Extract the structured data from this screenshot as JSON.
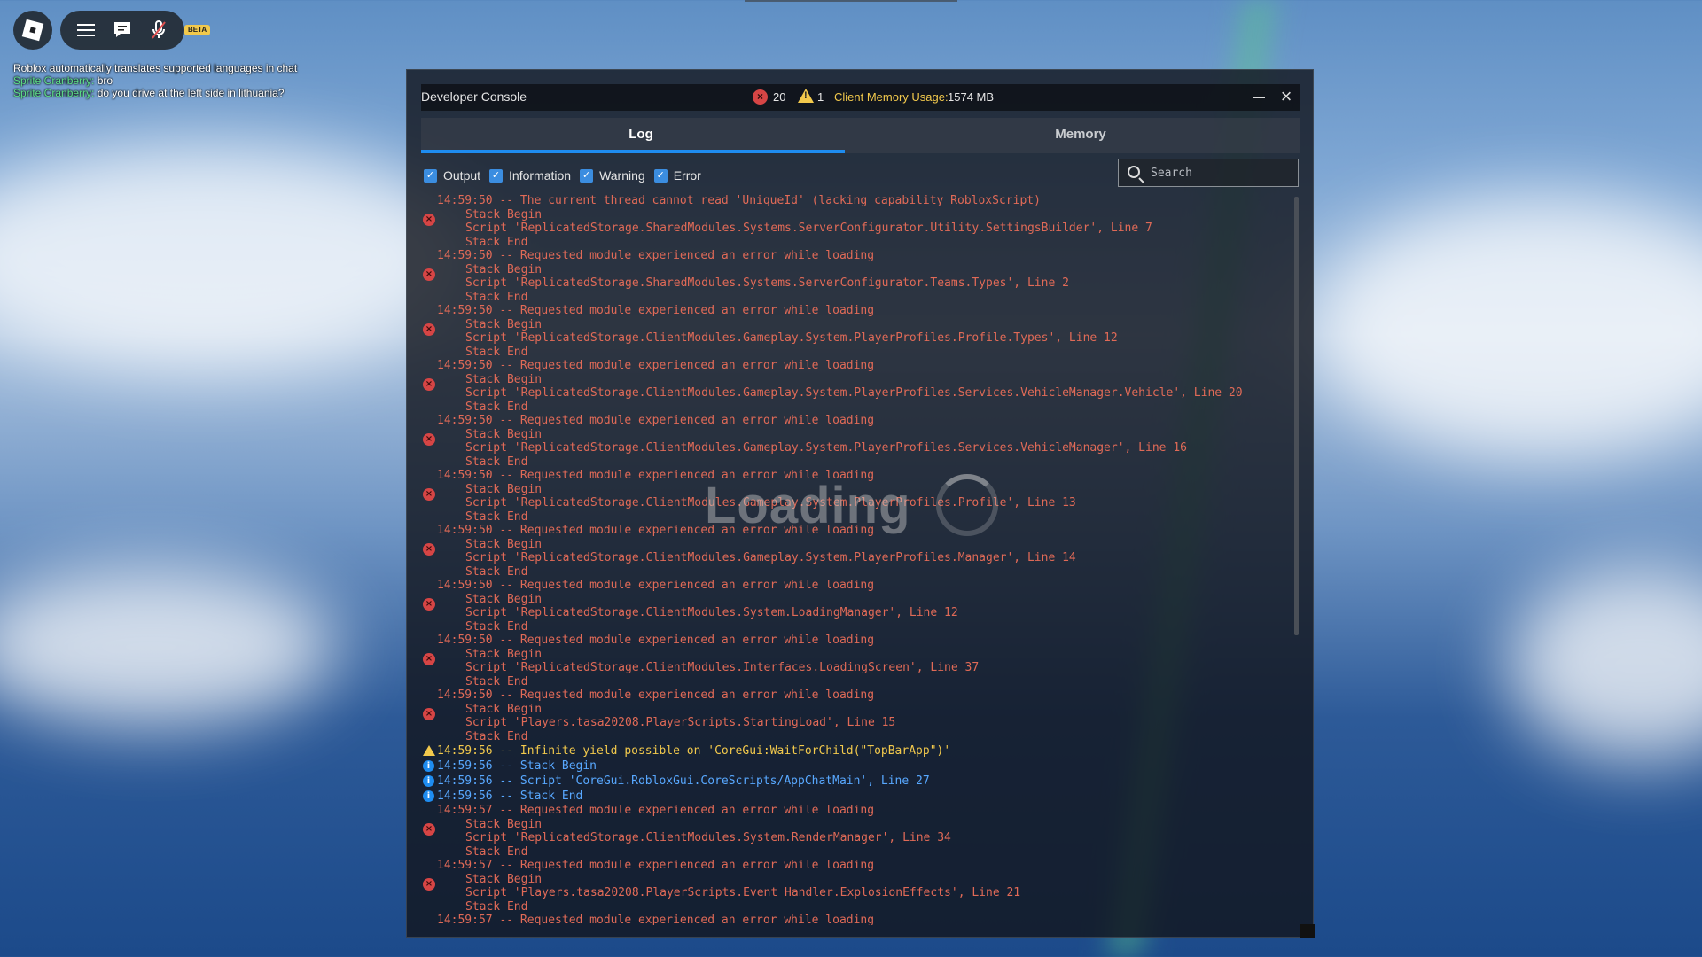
{
  "window": {
    "title": "Developer Console"
  },
  "stats": {
    "error_count": "20",
    "warning_count": "1",
    "memory_label": "Client Memory Usage:",
    "memory_value": "1574 MB"
  },
  "tabs": [
    {
      "label": "Log",
      "active": true
    },
    {
      "label": "Memory",
      "active": false
    }
  ],
  "filters": [
    {
      "label": "Output",
      "checked": true
    },
    {
      "label": "Information",
      "checked": true
    },
    {
      "label": "Warning",
      "checked": true
    },
    {
      "label": "Error",
      "checked": true
    }
  ],
  "search": {
    "placeholder": "Search"
  },
  "topbar": {
    "beta_label": "BETA"
  },
  "chat": {
    "notice": "Roblox automatically translates supported languages in chat",
    "messages": [
      {
        "speaker": "Sprite Cranberry:",
        "text": " bro"
      },
      {
        "speaker": "Sprite Cranberry:",
        "text": " do you drive at the left side in lithuania?"
      }
    ]
  },
  "overlay": {
    "loading_text": "Loading"
  },
  "log": [
    {
      "type": "error",
      "main": "14:59:50 -- The current thread cannot read 'UniqueId' (lacking capability RobloxScript)",
      "lines": [
        "Stack Begin",
        "Script 'ReplicatedStorage.SharedModules.Systems.ServerConfigurator.Utility.SettingsBuilder', Line 7",
        "Stack End"
      ]
    },
    {
      "type": "error",
      "main": "14:59:50 -- Requested module experienced an error while loading",
      "lines": [
        "Stack Begin",
        "Script 'ReplicatedStorage.SharedModules.Systems.ServerConfigurator.Teams.Types', Line 2",
        "Stack End"
      ]
    },
    {
      "type": "error",
      "main": "14:59:50 -- Requested module experienced an error while loading",
      "lines": [
        "Stack Begin",
        "Script 'ReplicatedStorage.ClientModules.Gameplay.System.PlayerProfiles.Profile.Types', Line 12",
        "Stack End"
      ]
    },
    {
      "type": "error",
      "main": "14:59:50 -- Requested module experienced an error while loading",
      "lines": [
        "Stack Begin",
        "Script 'ReplicatedStorage.ClientModules.Gameplay.System.PlayerProfiles.Services.VehicleManager.Vehicle', Line 20",
        "Stack End"
      ]
    },
    {
      "type": "error",
      "main": "14:59:50 -- Requested module experienced an error while loading",
      "lines": [
        "Stack Begin",
        "Script 'ReplicatedStorage.ClientModules.Gameplay.System.PlayerProfiles.Services.VehicleManager', Line 16",
        "Stack End"
      ]
    },
    {
      "type": "error",
      "main": "14:59:50 -- Requested module experienced an error while loading",
      "lines": [
        "Stack Begin",
        "Script 'ReplicatedStorage.ClientModules.Gameplay.System.PlayerProfiles.Profile', Line 13",
        "Stack End"
      ]
    },
    {
      "type": "error",
      "main": "14:59:50 -- Requested module experienced an error while loading",
      "lines": [
        "Stack Begin",
        "Script 'ReplicatedStorage.ClientModules.Gameplay.System.PlayerProfiles.Manager', Line 14",
        "Stack End"
      ]
    },
    {
      "type": "error",
      "main": "14:59:50 -- Requested module experienced an error while loading",
      "lines": [
        "Stack Begin",
        "Script 'ReplicatedStorage.ClientModules.System.LoadingManager', Line 12",
        "Stack End"
      ]
    },
    {
      "type": "error",
      "main": "14:59:50 -- Requested module experienced an error while loading",
      "lines": [
        "Stack Begin",
        "Script 'ReplicatedStorage.ClientModules.Interfaces.LoadingScreen', Line 37",
        "Stack End"
      ]
    },
    {
      "type": "error",
      "main": "14:59:50 -- Requested module experienced an error while loading",
      "lines": [
        "Stack Begin",
        "Script 'Players.tasa20208.PlayerScripts.StartingLoad', Line 15",
        "Stack End"
      ]
    },
    {
      "type": "warning",
      "main": "14:59:56 -- Infinite yield possible on 'CoreGui:WaitForChild(\"TopBarApp\")'"
    },
    {
      "type": "info",
      "main": "14:59:56 -- Stack Begin"
    },
    {
      "type": "info",
      "main": "14:59:56 -- Script 'CoreGui.RobloxGui.CoreScripts/AppChatMain', Line 27"
    },
    {
      "type": "info",
      "main": "14:59:56 -- Stack End"
    },
    {
      "type": "error",
      "main": "14:59:57 -- Requested module experienced an error while loading",
      "lines": [
        "Stack Begin",
        "Script 'ReplicatedStorage.ClientModules.System.RenderManager', Line 34",
        "Stack End"
      ]
    },
    {
      "type": "error",
      "main": "14:59:57 -- Requested module experienced an error while loading",
      "lines": [
        "Stack Begin",
        "Script 'Players.tasa20208.PlayerScripts.Event Handler.ExplosionEffects', Line 21",
        "Stack End"
      ]
    },
    {
      "type": "error",
      "main": "14:59:57 -- Requested module experienced an error while loading",
      "lines": []
    }
  ]
}
